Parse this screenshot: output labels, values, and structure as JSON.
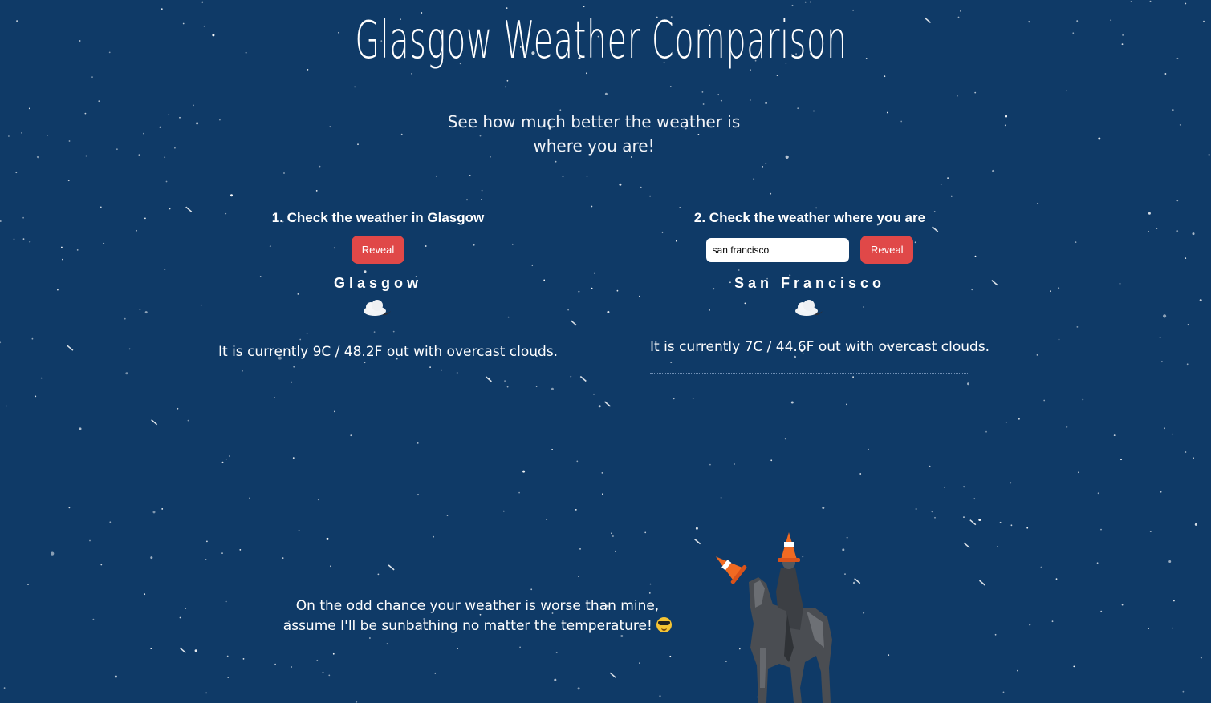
{
  "header": {
    "title": "Glasgow Weather Comparison",
    "subtitle": "See how much better the weather is where you are!"
  },
  "glasgow_panel": {
    "heading": "1. Check the weather in Glasgow",
    "reveal_label": "Reveal",
    "city": "Glasgow",
    "icon": "cloud-moon-icon",
    "description": "It is currently 9C / 48.2F out with overcast clouds."
  },
  "local_panel": {
    "heading": "2. Check the weather where you are",
    "input_value": "san francisco",
    "reveal_label": "Reveal",
    "city": "San Francisco",
    "icon": "cloud-moon-icon",
    "description": "It is currently 7C / 44.6F out with overcast clouds."
  },
  "footer": {
    "line1": "On the odd chance your weather is worse than mine,",
    "line2": "assume I'll be sunbathing no matter the temperature!",
    "emoji": "sunglasses-face-icon"
  },
  "colors": {
    "background": "#0f3a67",
    "button": "#e04848",
    "text": "#ffffff"
  }
}
